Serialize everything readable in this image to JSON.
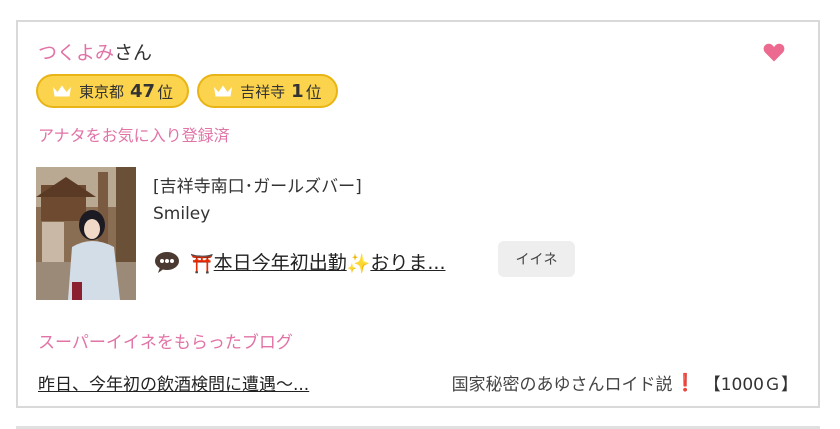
{
  "profile": {
    "name": "つくよみ",
    "suffix": "さん",
    "registered_text": "アナタをお気に入り登録済"
  },
  "badges": [
    {
      "area": "東京都",
      "rank": "47",
      "unit": "位"
    },
    {
      "area": "吉祥寺",
      "rank": "1",
      "unit": "位"
    }
  ],
  "post": {
    "shop": "[吉祥寺南口･ガールズバー]",
    "shop_name": "Smiley",
    "emoji_torii": "⛩️",
    "text_before": "本日",
    "text_underlined": "今年初出勤",
    "emoji_sparkles": "✨",
    "text_after": "おりま...",
    "iine_label": "イイネ"
  },
  "blog": {
    "heading": "スーパーイイネをもらったブログ",
    "link_text": "昨日、今年初の飲酒検問に遭遇〜...",
    "author": "国家秘密のあゆさんロイド説",
    "mark": "❗",
    "gold": "【1000Ｇ】"
  },
  "colors": {
    "pink": "#e173a6",
    "badge_yellow": "#fbd34c",
    "heart": "#ec6a8f"
  }
}
